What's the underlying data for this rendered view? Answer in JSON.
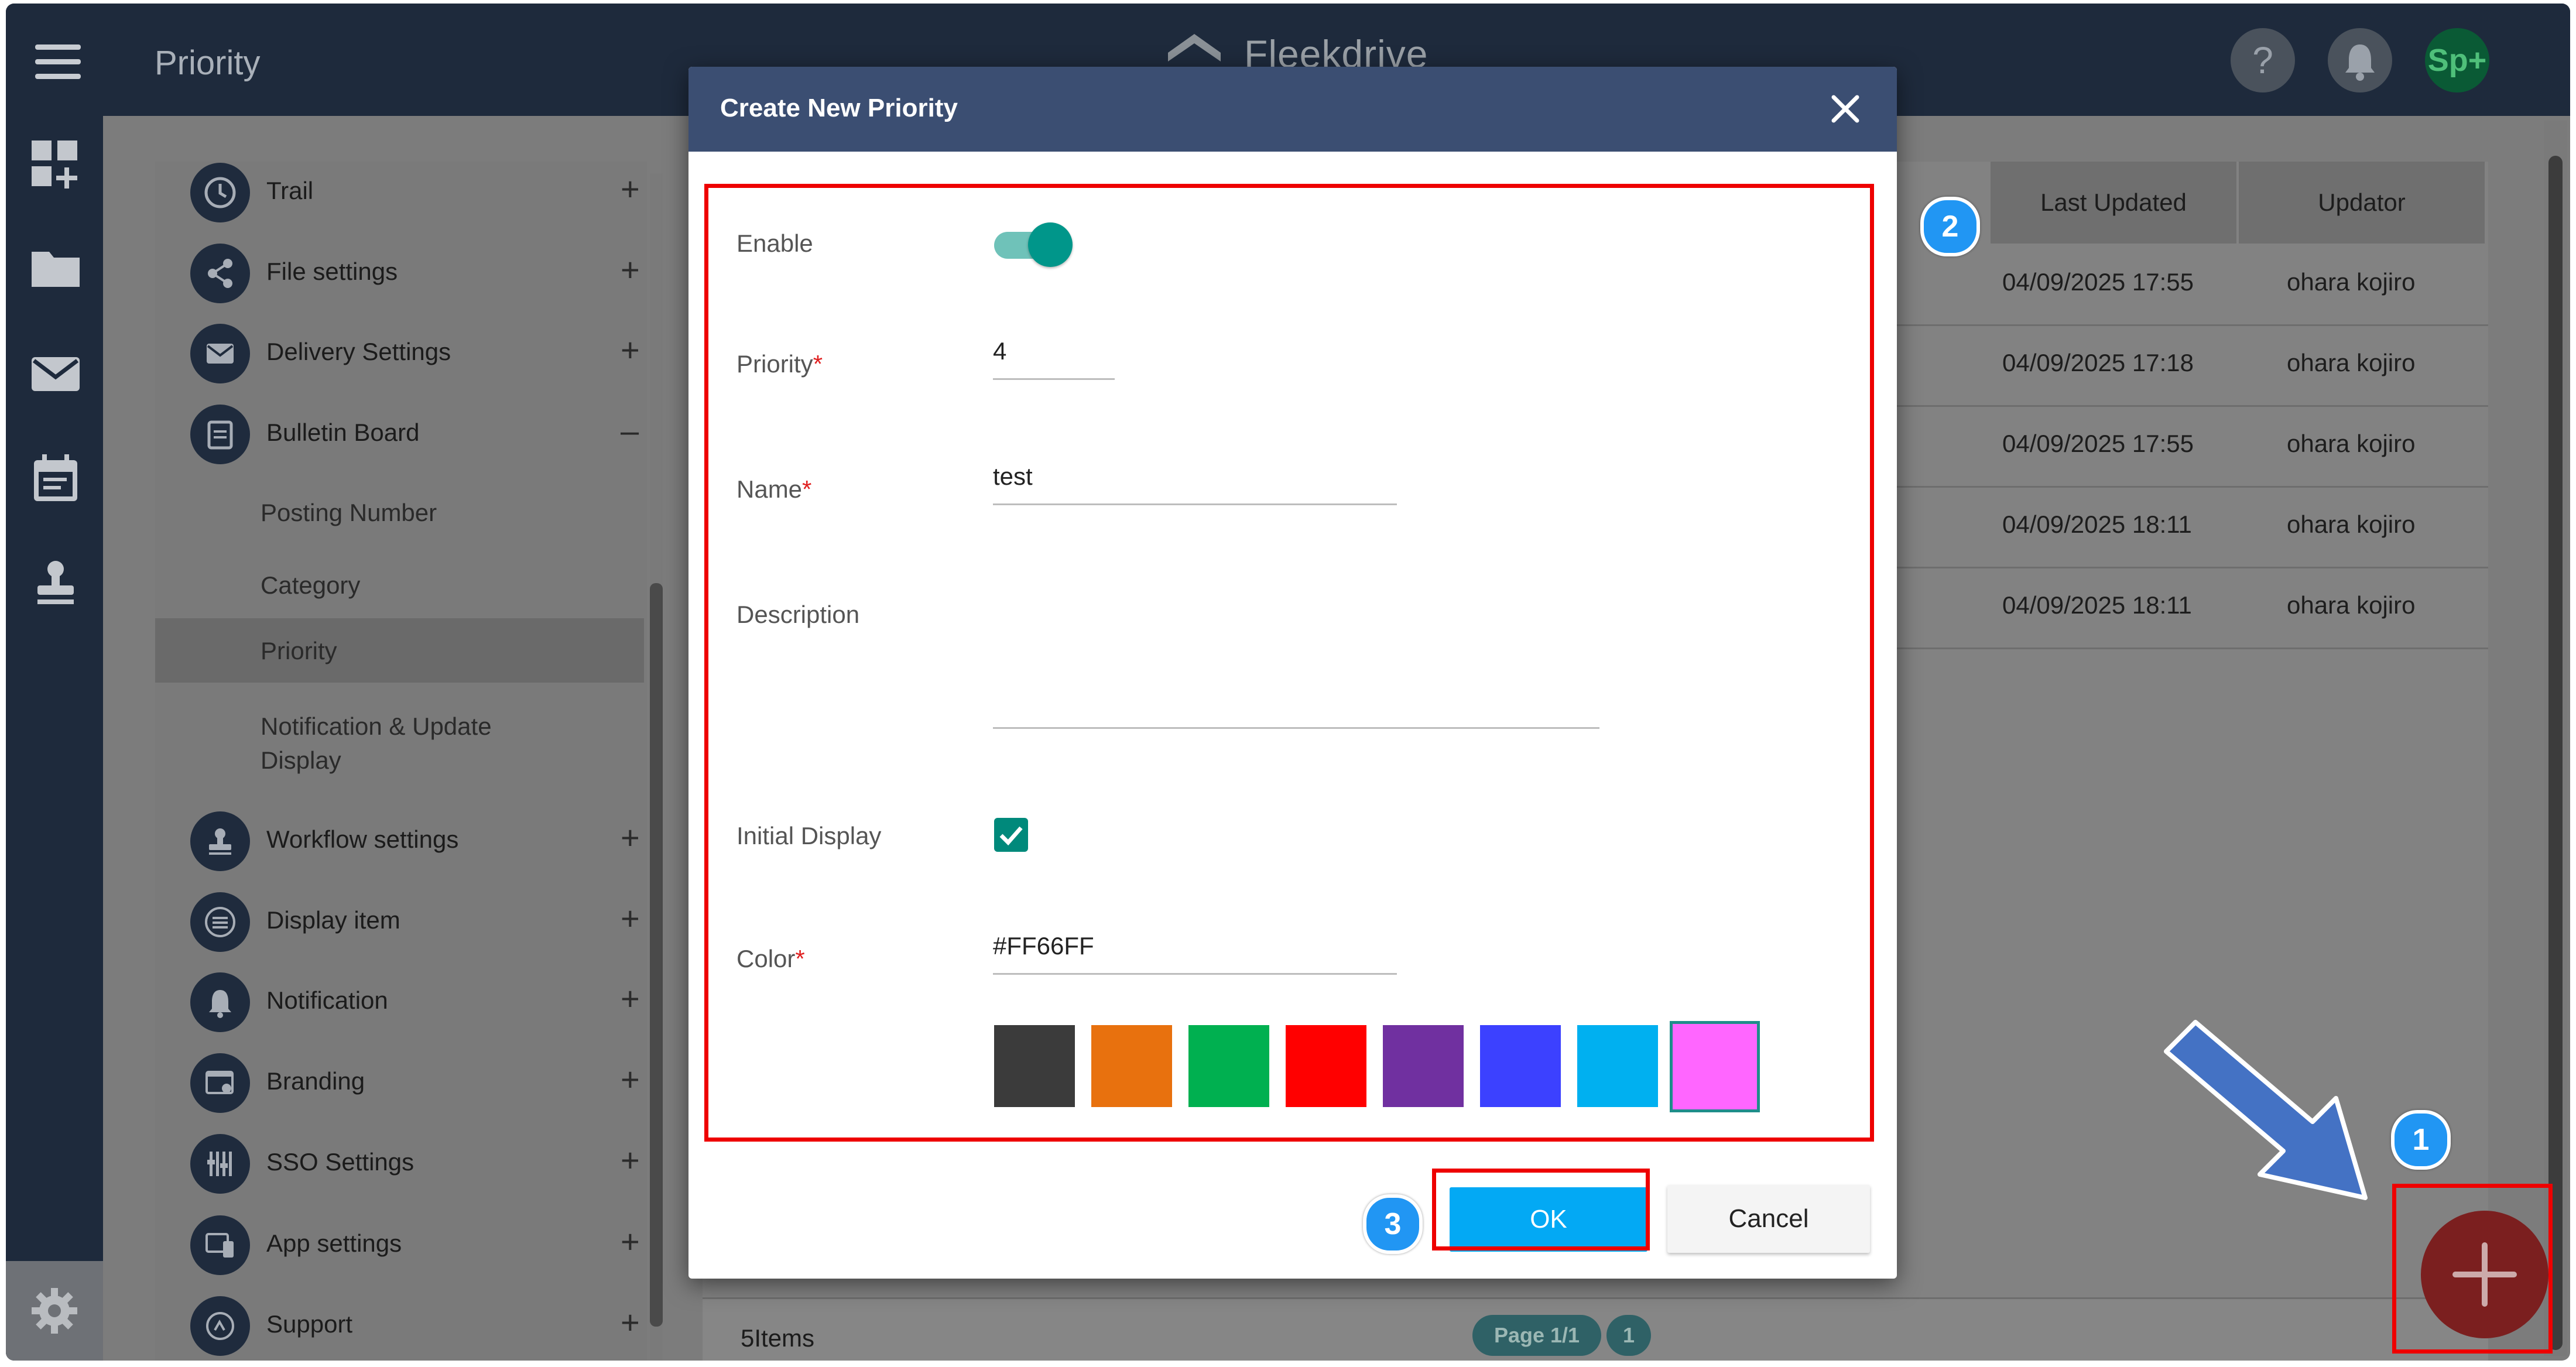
{
  "app": {
    "page_title": "Priority",
    "brand": "Fleekdrive",
    "help_icon": "?",
    "avatar_text": "Sp+"
  },
  "side_menu": {
    "items": [
      {
        "label": "Trail",
        "toggle": "+"
      },
      {
        "label": "File settings",
        "toggle": "+"
      },
      {
        "label": "Delivery Settings",
        "toggle": "+"
      },
      {
        "label": "Bulletin Board",
        "toggle": "–"
      },
      {
        "label": "Workflow settings",
        "toggle": "+"
      },
      {
        "label": "Display item",
        "toggle": "+"
      },
      {
        "label": "Notification",
        "toggle": "+"
      },
      {
        "label": "Branding",
        "toggle": "+"
      },
      {
        "label": "SSO Settings",
        "toggle": "+"
      },
      {
        "label": "App settings",
        "toggle": "+"
      },
      {
        "label": "Support",
        "toggle": "+"
      }
    ],
    "bulletin_sub_items": [
      "Posting Number",
      "Category",
      "Priority",
      "Notification & Update Display"
    ],
    "active_sub_item": "Priority"
  },
  "table": {
    "columns": [
      "Last Updated",
      "Updator"
    ],
    "rows": [
      {
        "last_updated": "04/09/2025 17:55",
        "updator": "ohara kojiro"
      },
      {
        "last_updated": "04/09/2025 17:18",
        "updator": "ohara kojiro"
      },
      {
        "last_updated": "04/09/2025 17:55",
        "updator": "ohara kojiro"
      },
      {
        "last_updated": "04/09/2025 18:11",
        "updator": "ohara kojiro"
      },
      {
        "last_updated": "04/09/2025 18:11",
        "updator": "ohara kojiro"
      }
    ],
    "items_count": "5Items",
    "page_label": "Page 1/1",
    "page_number": "1"
  },
  "modal": {
    "title": "Create New Priority",
    "enable_label": "Enable",
    "enable_on": true,
    "priority_label": "Priority",
    "priority_value": "4",
    "name_label": "Name",
    "name_value": "test",
    "description_label": "Description",
    "description_value": "",
    "initial_display_label": "Initial Display",
    "initial_display_checked": true,
    "color_label": "Color",
    "color_value": "#FF66FF",
    "required_mark": "*",
    "swatches": [
      "#3b3b3b",
      "#e8710e",
      "#00b050",
      "#ff0000",
      "#7030a0",
      "#3c41ff",
      "#00b0f0",
      "#ff66ff"
    ],
    "selected_swatch": "#ff66ff",
    "ok_label": "OK",
    "cancel_label": "Cancel"
  },
  "annotations": {
    "badge_1": "1",
    "badge_2": "2",
    "badge_3": "3"
  }
}
